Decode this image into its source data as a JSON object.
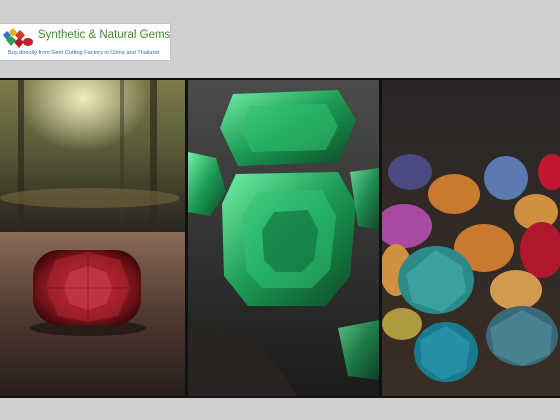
{
  "header": {
    "logo": {
      "title": "Synthetic & Natural Gems",
      "subtitle": "Buy directly from Gem Cutting Factory in China and Thailand",
      "icon": "gem-cluster-icon",
      "title_color": "#3f8a2a",
      "subtitle_color": "#2b6fb3"
    }
  },
  "gallery": {
    "images": [
      {
        "subject": "red-cushion-gem-on-table-forest-background",
        "accent": "#8e1a22"
      },
      {
        "subject": "green-emerald-cut-gems",
        "accent": "#1c9a55"
      },
      {
        "subject": "assorted-colored-faceted-gems",
        "accent": "#2d8a88"
      }
    ]
  }
}
